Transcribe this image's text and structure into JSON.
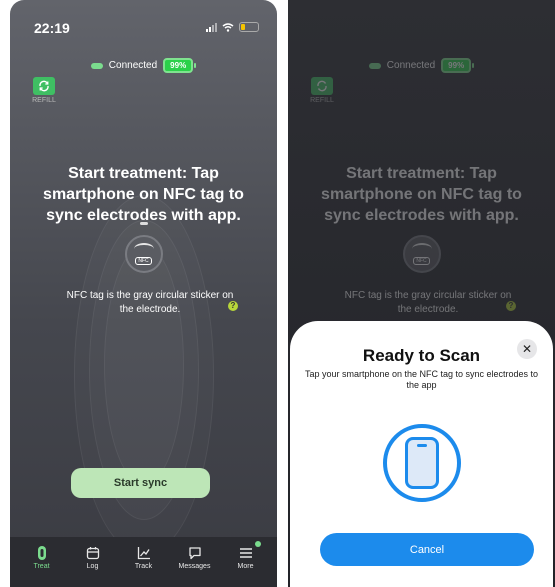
{
  "left": {
    "status_time": "22:19",
    "connection_text": "Connected",
    "battery_pct": "99%",
    "refill_label": "REFILL",
    "headline": "Start treatment: Tap smartphone on NFC tag to sync electrodes with app.",
    "nfc_chip": "NFC",
    "hint": "NFC tag is the gray circular sticker on the electrode.",
    "help_glyph": "?",
    "sync_button": "Start sync",
    "tabs": [
      {
        "label": "Treat",
        "icon": "treat-icon"
      },
      {
        "label": "Log",
        "icon": "calendar-icon"
      },
      {
        "label": "Track",
        "icon": "chart-icon"
      },
      {
        "label": "Messages",
        "icon": "chat-icon"
      },
      {
        "label": "More",
        "icon": "menu-icon"
      }
    ]
  },
  "right": {
    "connection_text": "Connected",
    "battery_pct": "99%",
    "refill_label": "REFILL",
    "headline": "Start treatment: Tap smartphone on NFC tag to sync electrodes with app.",
    "nfc_chip": "NFC",
    "hint": "NFC tag is the gray circular sticker on the electrode.",
    "help_glyph": "?",
    "sheet": {
      "title": "Ready to Scan",
      "close_glyph": "✕",
      "text": "Tap your smartphone on the NFC tag to sync electrodes to the app",
      "cancel": "Cancel"
    }
  },
  "colors": {
    "accent_green": "#7bdc8e",
    "battery_green": "#2bd14a",
    "ios_blue": "#1c8bec"
  }
}
